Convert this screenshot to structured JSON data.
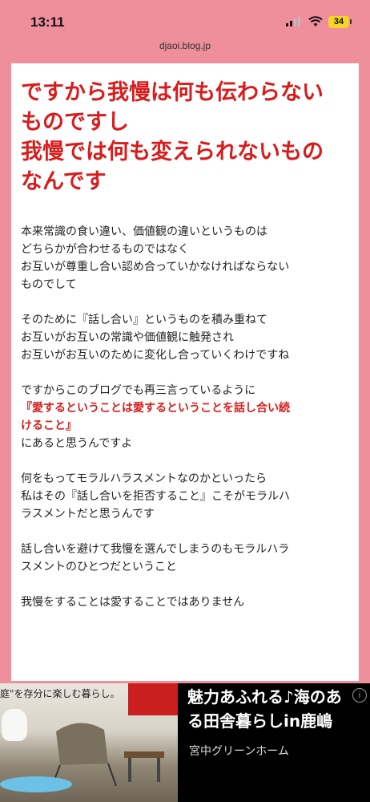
{
  "status_bar": {
    "time": "13:11",
    "battery": "34"
  },
  "browser": {
    "url": "djaoi.blog.jp"
  },
  "article": {
    "headline_lines": [
      "ですから我慢は何も伝わらない",
      "ものですし",
      "我慢では何も変えられないもの",
      "なんです"
    ],
    "paragraphs": [
      [
        "本来常識の食い違い、価値観の違いというものは",
        "どちらかが合わせるものではなく",
        "お互いが尊重し合い認め合っていかなければならない",
        "ものでして"
      ],
      [
        "そのために『話し合い』というものを積み重ねて",
        "お互いがお互いの常識や価値観に触発され",
        "お互いがお互いのために変化し合っていくわけですね"
      ],
      [
        "ですからこのブログでも再三言っているように"
      ],
      [
        "何をもってモラルハラスメントなのかといったら",
        "私はその『話し合いを拒否すること』こそがモラルハ",
        "ラスメントだと思うんです"
      ],
      [
        "話し合いを避けて我慢を選んでしまうのもモラルハラ",
        "スメントのひとつだということ"
      ],
      [
        "我慢をすることは愛することではありません"
      ]
    ],
    "emphasis_lines": [
      "『愛するということは愛するということを話し合い続",
      "けること』"
    ],
    "after_emphasis": "にあると思うんですよ"
  },
  "ad": {
    "banner_text": "庭\"を存分に楽しむ暮らし。",
    "title_lines": [
      "魅力あふれる♪海のあ",
      "る田舎暮らしin鹿嶋"
    ],
    "company": "宮中グリーンホーム",
    "info_icon": "i"
  },
  "colors": {
    "page_background": "#ef8f9c",
    "headline": "#d81c1c",
    "emphasis": "#d81c1c"
  }
}
